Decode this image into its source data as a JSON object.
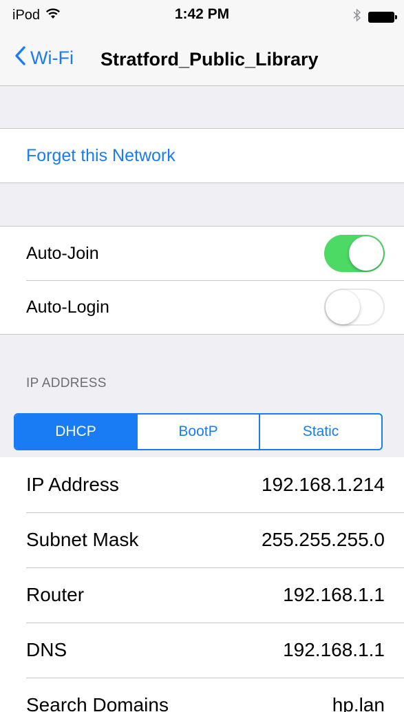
{
  "status_bar": {
    "carrier": "iPod",
    "time": "1:42 PM"
  },
  "nav": {
    "back_label": "Wi-Fi",
    "title": "Stratford_Public_Library"
  },
  "actions": {
    "forget_label": "Forget this Network"
  },
  "toggles": [
    {
      "label": "Auto-Join",
      "state": "on"
    },
    {
      "label": "Auto-Login",
      "state": "off"
    }
  ],
  "ip_section": {
    "header": "IP ADDRESS",
    "segments": [
      "DHCP",
      "BootP",
      "Static"
    ],
    "selected_segment": "DHCP"
  },
  "info_rows": [
    {
      "label": "IP Address",
      "value": "192.168.1.214"
    },
    {
      "label": "Subnet Mask",
      "value": "255.255.255.0"
    },
    {
      "label": "Router",
      "value": "192.168.1.1"
    },
    {
      "label": "DNS",
      "value": "192.168.1.1"
    },
    {
      "label": "Search Domains",
      "value": "hp.lan"
    }
  ],
  "icons": {
    "wifi": "wifi-icon",
    "bluetooth": "bluetooth-icon",
    "battery": "battery-icon",
    "back": "chevron-left-icon"
  },
  "colors": {
    "accent": "#1a7cf5",
    "toggle_on": "#4cd964",
    "grouped_background": "#efeff4",
    "separator": "#c8c7cc"
  }
}
